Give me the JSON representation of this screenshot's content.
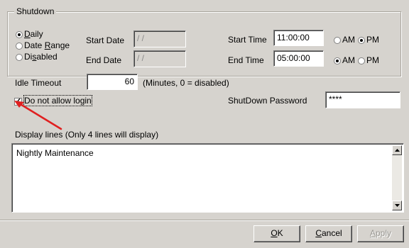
{
  "shutdown": {
    "group_label": "Shutdown",
    "schedule_options": [
      {
        "label": "Daily",
        "checked": true
      },
      {
        "label": "Date Range",
        "checked": false
      },
      {
        "label": "Disabled",
        "checked": false
      }
    ],
    "start_date_label": "Start Date",
    "start_date_value": "/ /",
    "end_date_label": "End Date",
    "end_date_value": "/ /",
    "start_time_label": "Start Time",
    "start_time_value": "11:00:00",
    "start_am_label": "AM",
    "start_pm_label": "PM",
    "start_meridiem": "PM",
    "end_time_label": "End Time",
    "end_time_value": "05:00:00",
    "end_am_label": "AM",
    "end_pm_label": "PM",
    "end_meridiem": "AM"
  },
  "idle": {
    "label": "Idle Timeout",
    "value": "60",
    "hint": "(Minutes, 0 = disabled)"
  },
  "login": {
    "checkbox_label": "Do not allow login",
    "checked": true
  },
  "password": {
    "label": "ShutDown Password",
    "value": "****"
  },
  "display_lines": {
    "label": "Display lines (Only 4 lines will display)",
    "text": "Nightly Maintenance"
  },
  "buttons": {
    "ok": "OK",
    "cancel": "Cancel",
    "apply": "Apply"
  },
  "annotation": {
    "arrow_color": "#e02020"
  }
}
